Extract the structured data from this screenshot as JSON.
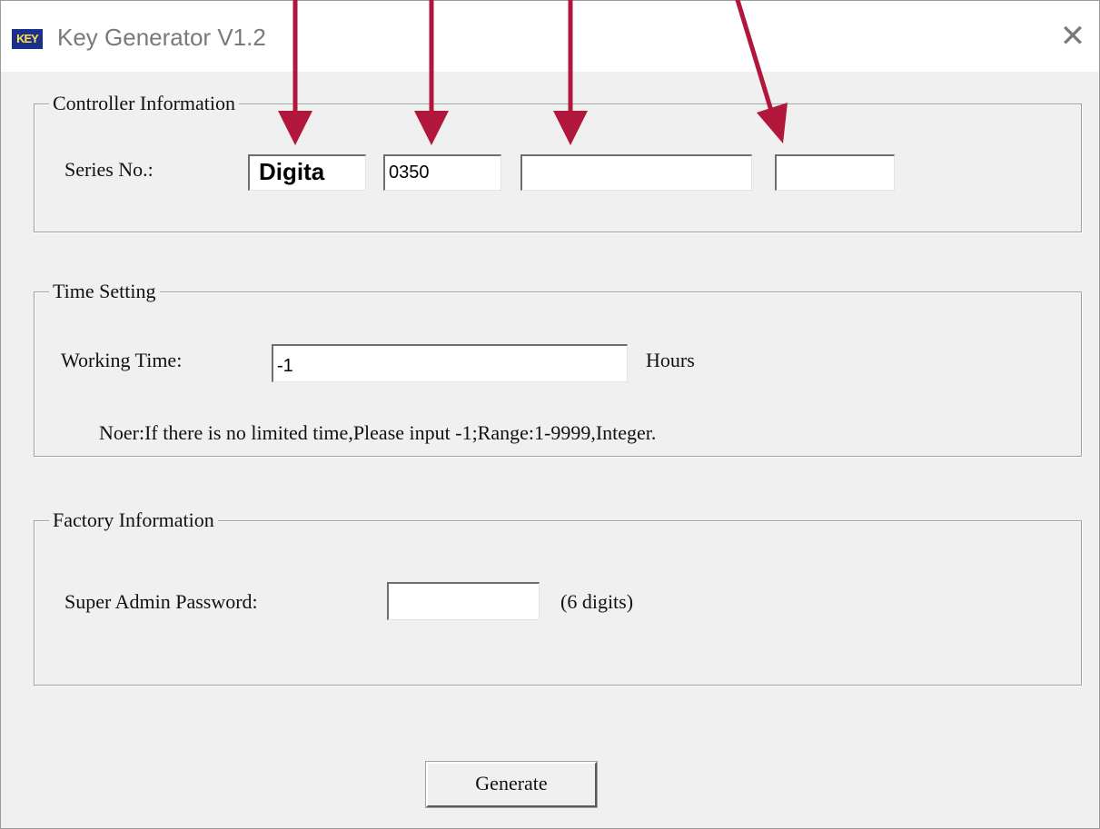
{
  "window": {
    "icon_text": "KEY",
    "title": "Key Generator V1.2",
    "close_glyph": "✕"
  },
  "controller_info": {
    "legend": "Controller Information",
    "series_label": "Series No.:",
    "series_fields": [
      "Digita",
      "0350",
      "",
      ""
    ]
  },
  "time_setting": {
    "legend": "Time Setting",
    "working_time_label": "Working Time:",
    "working_time_value": "-1",
    "unit": "Hours",
    "note": "Noer:If there is no limited time,Please input -1;Range:1-9999,Integer."
  },
  "factory_info": {
    "legend": "Factory Information",
    "password_label": "Super Admin Password:",
    "password_value": "",
    "hint": "(6 digits)"
  },
  "actions": {
    "generate_label": "Generate"
  },
  "annotation": {
    "arrow_color": "#b0173a"
  }
}
